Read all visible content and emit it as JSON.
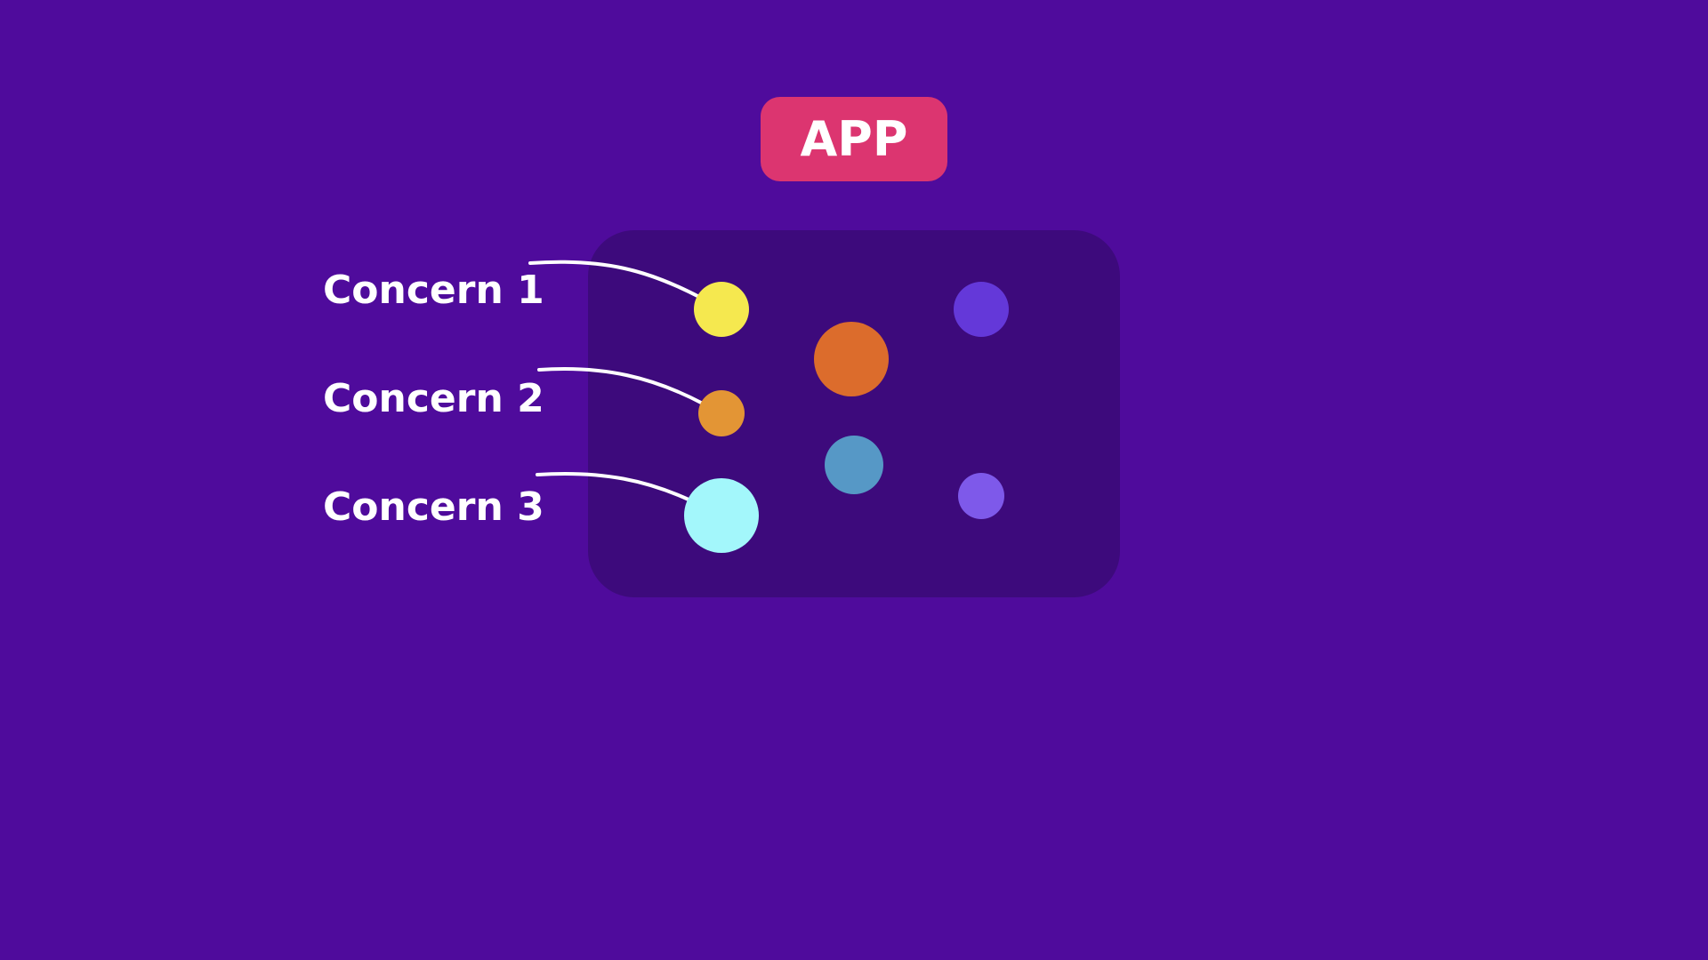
{
  "app_badge": {
    "label": "APP",
    "color": "#dc3570"
  },
  "background_color": "#4f0b9c",
  "panel_color": "#3d0a7c",
  "concerns": [
    {
      "label": "Concern 1",
      "color": "#f5e84f"
    },
    {
      "label": "Concern 2",
      "color": "#e39535"
    },
    {
      "label": "Concern 3",
      "color": "#a3f7fb"
    }
  ],
  "other_nodes": [
    {
      "name": "orange",
      "color": "#dc6c2c"
    },
    {
      "name": "steel-blue",
      "color": "#5698c6"
    },
    {
      "name": "indigo",
      "color": "#6438d9"
    },
    {
      "name": "lavender",
      "color": "#7e59ea"
    }
  ],
  "connector_color": "#ffffff"
}
